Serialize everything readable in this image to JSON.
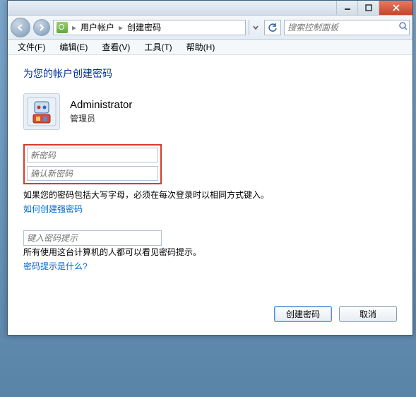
{
  "window_controls": {
    "minimize": "minimize",
    "maximize": "maximize",
    "close": "close"
  },
  "breadcrumb": {
    "level1": "用户帐户",
    "level2": "创建密码"
  },
  "search": {
    "placeholder": "搜索控制面板"
  },
  "menu": {
    "file": "文件(F)",
    "edit": "编辑(E)",
    "view": "查看(V)",
    "tools": "工具(T)",
    "help": "帮助(H)"
  },
  "page": {
    "title": "为您的帐户创建密码",
    "user_name": "Administrator",
    "user_role": "管理员",
    "new_password_placeholder": "新密码",
    "confirm_password_placeholder": "确认新密码",
    "caps_note": "如果您的密码包括大写字母，必须在每次登录时以相同方式键入。",
    "link_strong_pw": "如何创建强密码",
    "hint_placeholder": "键入密码提示",
    "hint_note": "所有使用这台计算机的人都可以看见密码提示。",
    "link_hint_what": "密码提示是什么?",
    "btn_create": "创建密码",
    "btn_cancel": "取消"
  },
  "colors": {
    "accent_link": "#0066cc",
    "title_blue": "#003399",
    "highlight_red": "#d93a2b"
  }
}
